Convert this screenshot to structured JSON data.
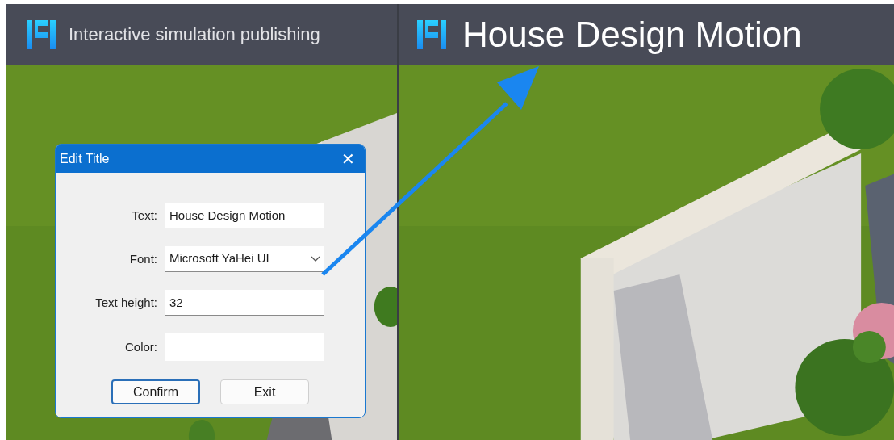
{
  "left_header": {
    "title": "Interactive simulation publishing"
  },
  "right_header": {
    "title": "House Design Motion"
  },
  "dialog": {
    "title": "Edit Title",
    "close": "✕",
    "fields": [
      {
        "kind": "text",
        "label": "Text:",
        "value": "House Design Motion"
      },
      {
        "kind": "select",
        "label": "Font:",
        "value": "Microsoft YaHei UI"
      },
      {
        "kind": "text",
        "label": "Text height:",
        "value": "32"
      },
      {
        "kind": "color",
        "label": "Color:",
        "color": "#ffffff"
      }
    ],
    "buttons": [
      {
        "label": "Confirm",
        "selected": true
      },
      {
        "label": "Exit",
        "selected": false
      }
    ]
  }
}
